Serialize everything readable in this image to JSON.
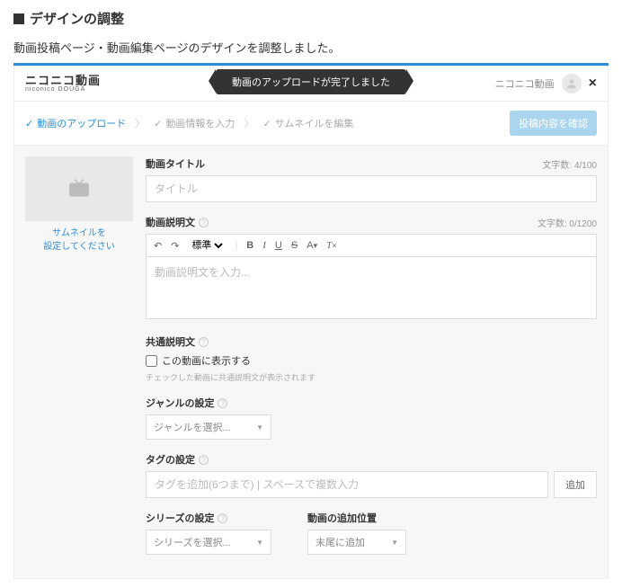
{
  "section_title": "デザインの調整",
  "intro": "動画投稿ページ・動画編集ページのデザインを調整しました。",
  "logo": {
    "jp": "ニコニコ動画",
    "en": "niconico DOUGA"
  },
  "toast": "動画のアップロードが完了しました",
  "user_name": "ニコニコ動画",
  "steps": {
    "s1": "動画のアップロード",
    "s2": "動画情報を入力",
    "s3": "サムネイルを編集",
    "confirm": "投稿内容を確認"
  },
  "thumb": {
    "l1": "サムネイルを",
    "l2": "設定してください"
  },
  "title_field": {
    "label": "動画タイトル",
    "count": "文字数: 4/100",
    "placeholder": "タイトル"
  },
  "desc_field": {
    "label": "動画説明文",
    "count": "文字数: 0/1200",
    "placeholder": "動画説明文を入力...",
    "style_label": "標準"
  },
  "common_desc": {
    "label": "共通説明文",
    "checkbox": "この動画に表示する",
    "hint": "チェックした動画に共通説明文が表示されます"
  },
  "genre": {
    "label": "ジャンルの設定",
    "placeholder": "ジャンルを選択..."
  },
  "tag": {
    "label": "タグの設定",
    "placeholder": "タグを追加(6つまで) | スペースで複数入力",
    "add": "追加"
  },
  "series": {
    "label": "シリーズの設定",
    "placeholder": "シリーズを選択..."
  },
  "position": {
    "label": "動画の追加位置",
    "value": "末尾に追加"
  }
}
